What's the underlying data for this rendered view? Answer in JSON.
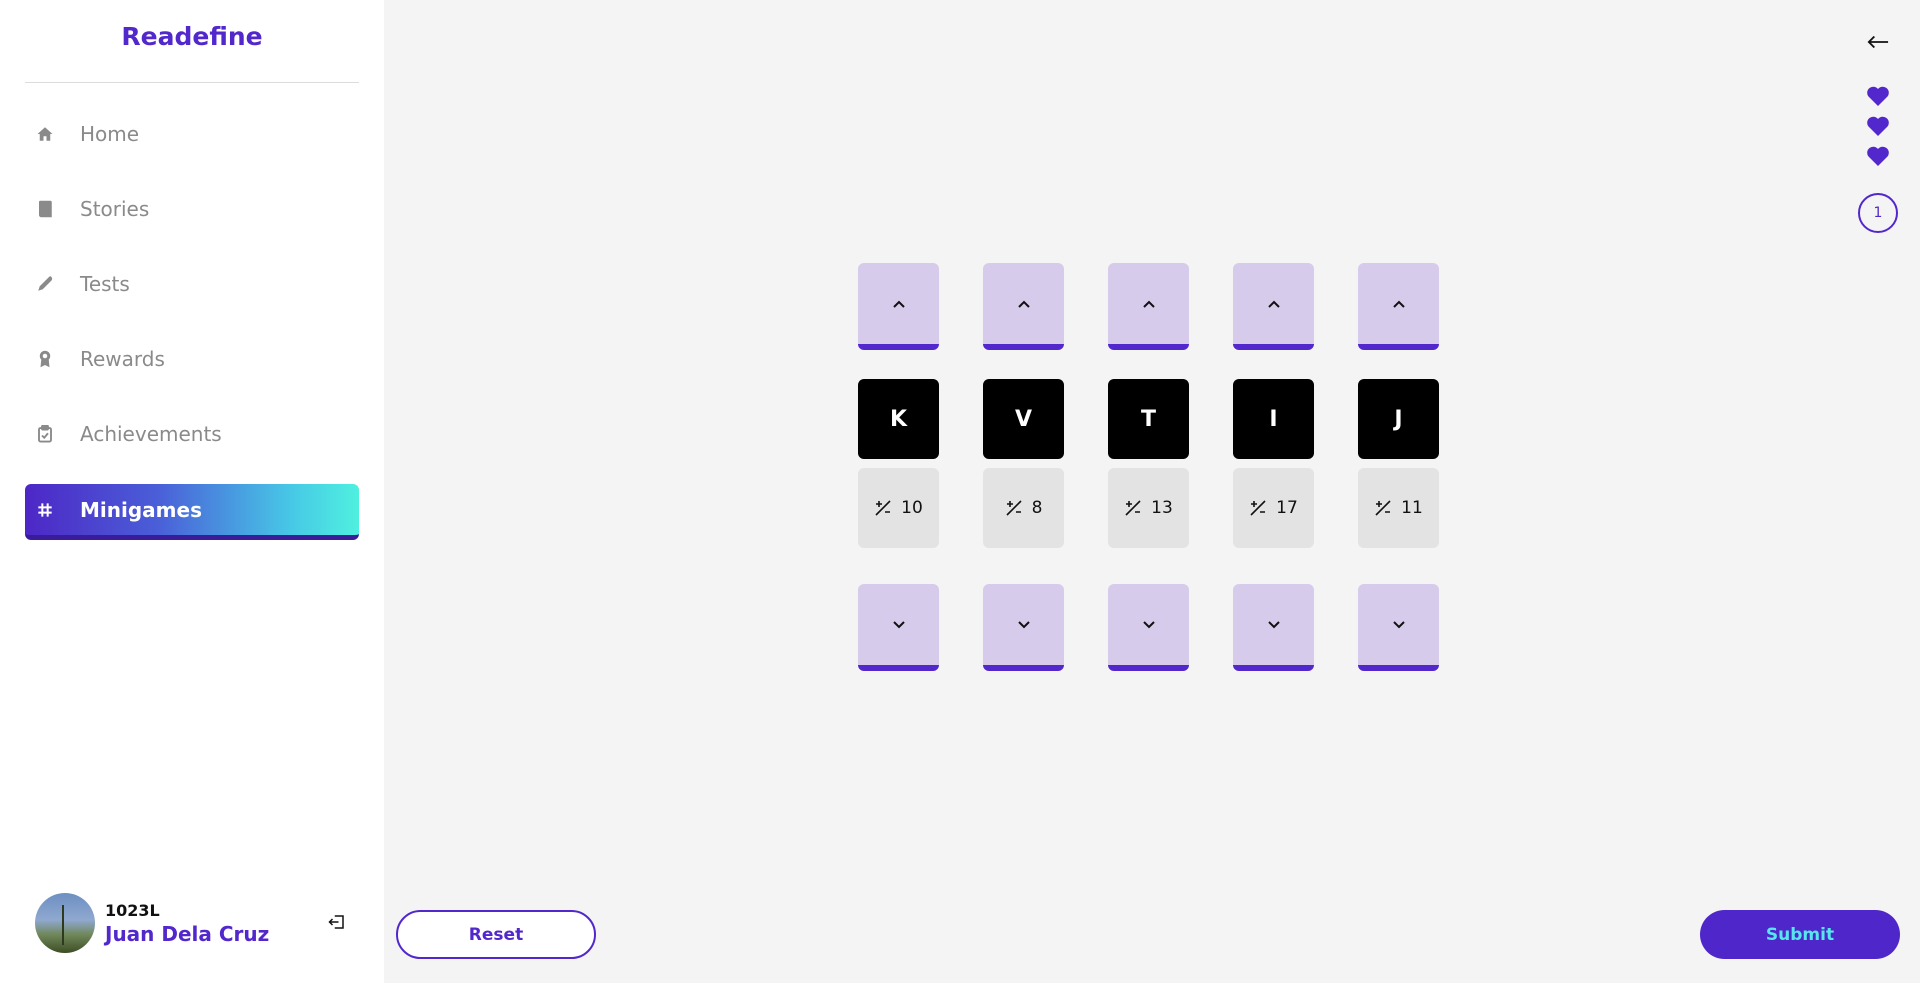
{
  "app": {
    "brand": "Readefine"
  },
  "sidebar": {
    "items": [
      {
        "label": "Home",
        "icon": "home-icon",
        "active": false
      },
      {
        "label": "Stories",
        "icon": "book-icon",
        "active": false
      },
      {
        "label": "Tests",
        "icon": "pen-icon",
        "active": false
      },
      {
        "label": "Rewards",
        "icon": "award-icon",
        "active": false
      },
      {
        "label": "Achievements",
        "icon": "clipboard-check-icon",
        "active": false
      },
      {
        "label": "Minigames",
        "icon": "grid-icon",
        "active": true
      }
    ]
  },
  "profile": {
    "id": "1023L",
    "name": "Juan Dela Cruz"
  },
  "game": {
    "lives": 3,
    "round": "1",
    "columns": [
      {
        "letter": "K",
        "shift": "10"
      },
      {
        "letter": "V",
        "shift": "8"
      },
      {
        "letter": "T",
        "shift": "13"
      },
      {
        "letter": "I",
        "shift": "17"
      },
      {
        "letter": "J",
        "shift": "11"
      }
    ]
  },
  "actions": {
    "reset_label": "Reset",
    "submit_label": "Submit"
  },
  "colors": {
    "accent": "#5227cc",
    "tile_light": "#d6cbeb",
    "submit_text": "#57e6ee"
  }
}
